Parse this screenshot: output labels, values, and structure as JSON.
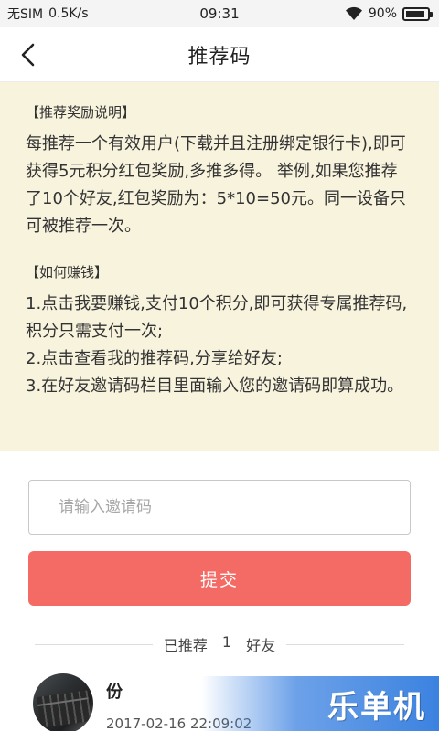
{
  "status_bar": {
    "carrier": "无SIM",
    "speed": "0.5K/s",
    "time": "09:31",
    "battery": "90%",
    "battery_level": 0.9
  },
  "header": {
    "title": "推荐码"
  },
  "info": {
    "reward_heading": "【推荐奖励说明】",
    "reward_body": "每推荐一个有效用户(下载并且注册绑定银行卡),即可获得5元积分红包奖励,多推多得。 举例,如果您推荐了10个好友,红包奖励为：5*10=50元。同一设备只可被推荐一次。",
    "earn_heading": "【如何赚钱】",
    "earn_steps": [
      "1.点击我要赚钱,支付10个积分,即可获得专属推荐码,积分只需支付一次;",
      "2.点击查看我的推荐码,分享给好友;",
      "3.在好友邀请码栏目里面输入您的邀请码即算成功。"
    ]
  },
  "form": {
    "invite_placeholder": "请输入邀请码",
    "invite_value": "",
    "submit_label": "提交"
  },
  "referrals": {
    "prefix": "已推荐",
    "count": "1",
    "suffix": "好友",
    "items": [
      {
        "name": "份",
        "time": "2017-02-16 22:09:02"
      }
    ]
  },
  "watermark": {
    "text": "乐单机"
  },
  "colors": {
    "info_background": "#f8f3dd",
    "submit_button": "#f46b65",
    "watermark_blue": "#3b82e0"
  }
}
